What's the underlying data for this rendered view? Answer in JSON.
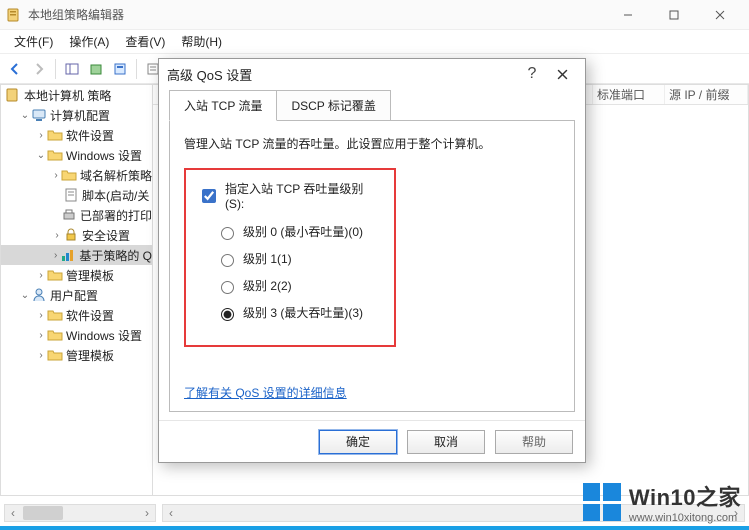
{
  "window": {
    "title": "本地组策略编辑器",
    "min_tip": "最小化",
    "max_tip": "最大化",
    "close_tip": "关闭"
  },
  "menu": {
    "file": "文件(F)",
    "action": "操作(A)",
    "view": "查看(V)",
    "help": "帮助(H)"
  },
  "tree": {
    "root": "本地计算机 策略",
    "comp_cfg": "计算机配置",
    "sw": "软件设置",
    "win": "Windows 设置",
    "dns": "域名解析策略",
    "scripts": "脚本(启动/关",
    "printers": "已部署的打印",
    "security": "安全设置",
    "qos": "基于策略的 Q",
    "tmpl1": "管理模板",
    "user_cfg": "用户配置",
    "usw": "软件设置",
    "uwin": "Windows 设置",
    "utmpl": "管理模板"
  },
  "grid": {
    "col_stdport": "标准端口",
    "col_srcip": "源 IP / 前缀"
  },
  "dialog": {
    "title": "高级 QoS 设置",
    "tab1": "入站 TCP 流量",
    "tab2": "DSCP 标记覆盖",
    "desc": "管理入站 TCP 流量的吞吐量。此设置应用于整个计算机。",
    "chk_label": "指定入站 TCP 吞吐量级别(S):",
    "r0": "级别 0 (最小吞吐量)(0)",
    "r1": "级别 1(1)",
    "r2": "级别 2(2)",
    "r3": "级别 3 (最大吞吐量)(3)",
    "link": "了解有关 QoS 设置的详细信息",
    "ok": "确定",
    "cancel": "取消",
    "help": "帮助"
  },
  "watermark": {
    "main": "Win10之家",
    "sub": "www.win10xitong.com"
  }
}
